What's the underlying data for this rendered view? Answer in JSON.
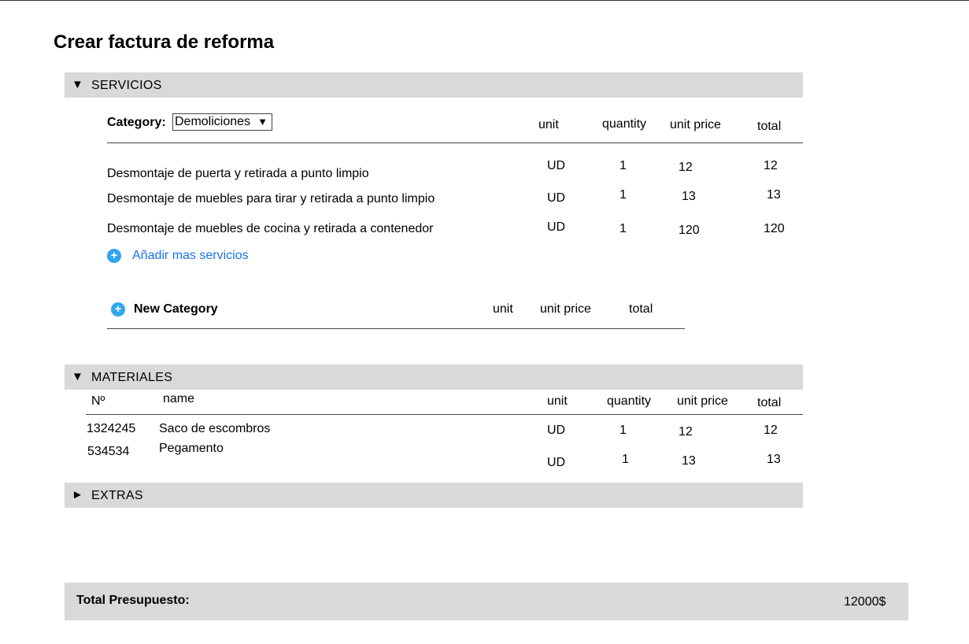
{
  "page": {
    "title": "Crear factura de reforma"
  },
  "servicios": {
    "section_label": "SERVICIOS",
    "toggle_icon": "▼",
    "category_label": "Category:",
    "category_value": "Demoliciones",
    "dropdown_icon": "▼",
    "headers": {
      "unit": "unit",
      "quantity": "quantity",
      "unit_price": "unit price",
      "total": "total"
    },
    "rows": [
      {
        "name": "Desmontaje de puerta y retirada a punto limpio",
        "unit": "UD",
        "quantity": "1",
        "unit_price": "12",
        "total": "12"
      },
      {
        "name": "Desmontaje de muebles para tirar y retirada a punto limpio",
        "unit": "UD",
        "quantity": "1",
        "unit_price": "13",
        "total": "13"
      },
      {
        "name": "Desmontaje de muebles de cocina y retirada a contenedor",
        "unit": "UD",
        "quantity": "1",
        "unit_price": "120",
        "total": "120"
      }
    ],
    "add_services_label": "Añadir mas servicios",
    "new_category": {
      "label": "New Category",
      "headers": {
        "unit": "unit",
        "unit_price": "unit price",
        "total": "total"
      }
    }
  },
  "materiales": {
    "section_label": "MATERIALES",
    "toggle_icon": "▼",
    "headers": {
      "num": "Nº",
      "name": "name",
      "unit": "unit",
      "quantity": "quantity",
      "unit_price": "unit price",
      "total": "total"
    },
    "rows": [
      {
        "num": "1324245",
        "name": "Saco de escombros",
        "unit": "UD",
        "quantity": "1",
        "unit_price": "12",
        "total": "12"
      },
      {
        "num": "534534",
        "name": "Pegamento",
        "unit": "UD",
        "quantity": "1",
        "unit_price": "13",
        "total": "13"
      }
    ]
  },
  "extras": {
    "section_label": "EXTRAS",
    "toggle_icon": "►"
  },
  "total": {
    "label": "Total Presupuesto:",
    "value": "12000$"
  },
  "colors": {
    "section_bar": "#d9d9d9",
    "accent_blue": "#2fa6ee",
    "link_blue": "#1a73e8"
  }
}
